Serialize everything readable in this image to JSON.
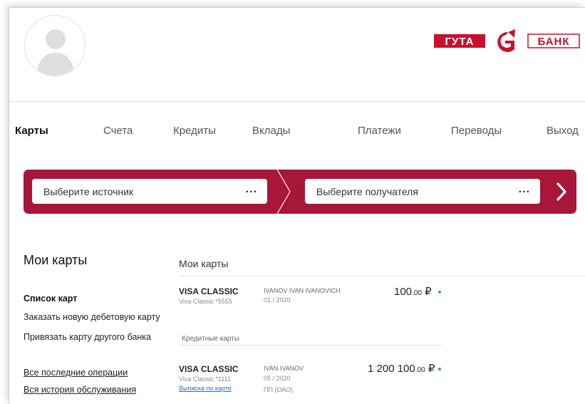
{
  "header": {
    "avatar_icon": "user-silhouette-icon",
    "logo": {
      "left_text": "ГУТА",
      "right_text": "БАНК",
      "brand_color": "#c8102e"
    }
  },
  "nav": {
    "items": [
      {
        "label": "Карты",
        "active": true
      },
      {
        "label": "Счета",
        "active": false
      },
      {
        "label": "Кредиты",
        "active": false
      },
      {
        "label": "Вклады",
        "active": false
      },
      {
        "label": "Платежи",
        "active": false
      },
      {
        "label": "Переводы",
        "active": false
      },
      {
        "label": "Выход",
        "active": false
      }
    ]
  },
  "transfer": {
    "accent_color": "#a8163a",
    "source_placeholder": "Выберите источник",
    "recipient_placeholder": "Выберите получателя",
    "more_label": "...",
    "go_icon": "chevron-right-icon"
  },
  "sidebar": {
    "title": "Мои карты",
    "items": {
      "card_list": "Список карт",
      "order_debit": "Заказать новую дебетовую карту",
      "link_other": "Привязать карту другого банка",
      "recent_ops": "Все последние операции",
      "history": "Вся история обслуживания"
    }
  },
  "main": {
    "title": "Мои карты",
    "cards": [
      {
        "name": "VISA CLASSIC",
        "number": "Visa Classic *5555",
        "holder": "IVANOV IVAN IVANOVICH",
        "expiry": "01 / 2020",
        "amount_major": "100",
        "amount_minor": ".00",
        "currency": "₽"
      }
    ],
    "credit_section_label": "Кредитные карты",
    "credit_cards": [
      {
        "name": "VISA CLASSIC",
        "number": "Visa Classic *1111",
        "link": "Выписка по карте",
        "holder": "IVAN IVANOV",
        "expiry": "05 / 2020",
        "type": "ПП (ОАО)",
        "amount_major": "1 200 100",
        "amount_minor": ".00",
        "currency": "₽"
      }
    ],
    "status_color": "#2fb34a"
  }
}
